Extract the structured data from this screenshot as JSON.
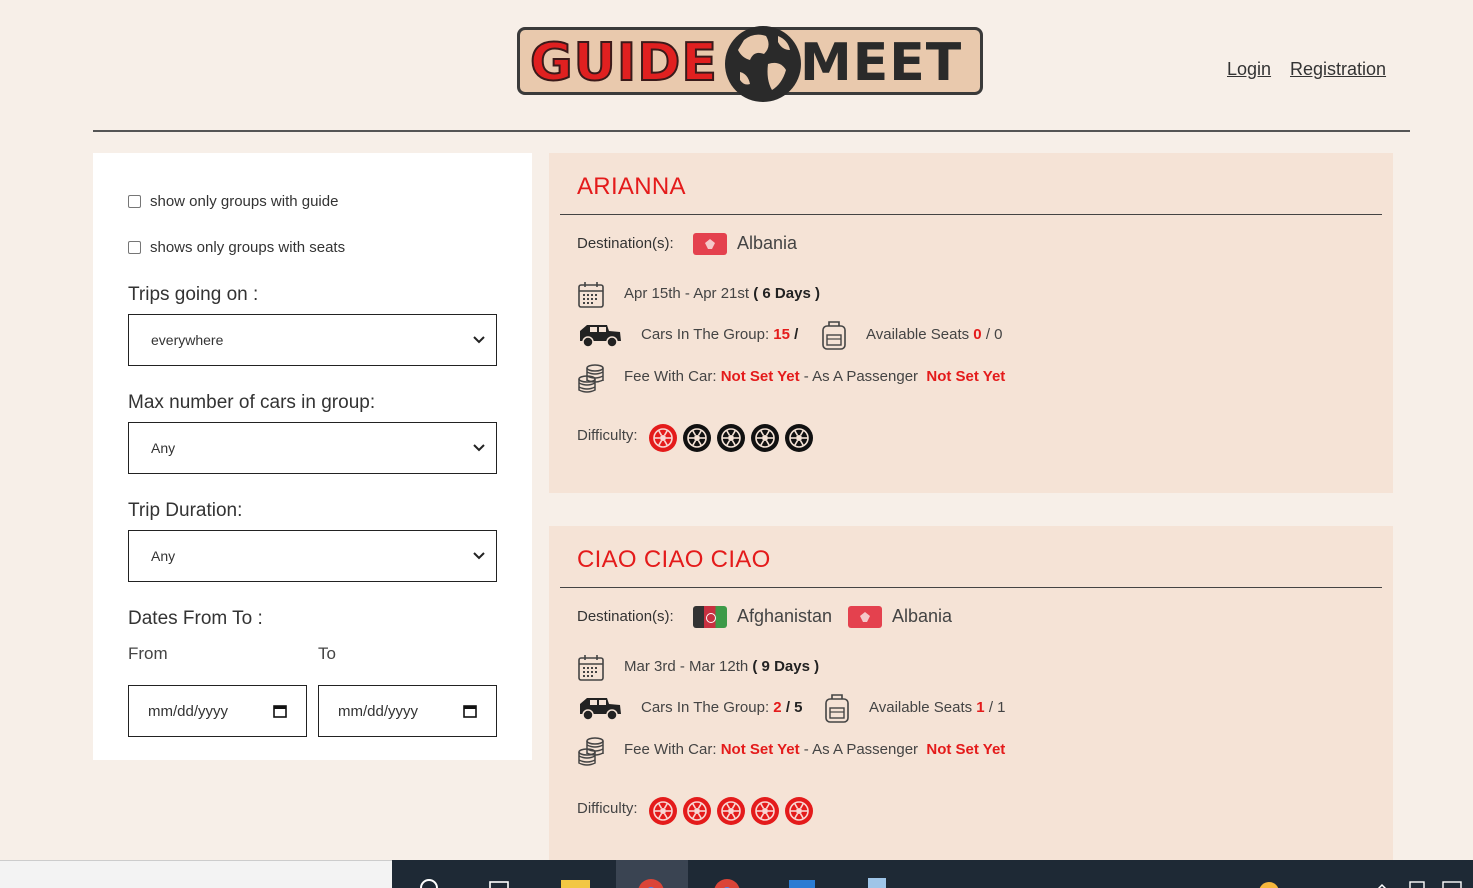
{
  "header": {
    "logo_text_left": "GUIDE",
    "logo_text_right": "MEET",
    "login": "Login",
    "registration": "Registration"
  },
  "filters": {
    "guide_checkbox_label": "show only groups with guide",
    "seats_checkbox_label": "shows only groups with seats",
    "trips_label": "Trips going on :",
    "trips_value": "everywhere",
    "cars_label": "Max number of cars in group:",
    "cars_value": "Any",
    "duration_label": "Trip Duration:",
    "duration_value": "Any",
    "dates_label": "Dates From To :",
    "from_label": "From",
    "to_label": "To",
    "from_placeholder": "mm/dd/yyyy",
    "to_placeholder": "mm/dd/yyyy"
  },
  "trips": [
    {
      "name": "ARIANNA",
      "dest_label": "Destination(s):",
      "destinations": [
        "Albania"
      ],
      "date_range": "Apr 15th - Apr 21st",
      "duration": "( 6 Days )",
      "cars_label": "Cars In The Group:",
      "cars_current": "15",
      "cars_sep": "/",
      "cars_max": "",
      "seats_label": "Available Seats",
      "seats_current": "0",
      "seats_sep": "/ 0",
      "fee_label": "Fee With Car:",
      "fee_car": "Not Set Yet",
      "fee_passenger_label": "- As A Passenger",
      "fee_passenger": "Not Set Yet",
      "difficulty_label": "Difficulty:",
      "difficulty": 1,
      "difficulty_max": 5
    },
    {
      "name": "CIAO CIAO CIAO",
      "dest_label": "Destination(s):",
      "destinations": [
        "Afghanistan",
        "Albania"
      ],
      "date_range": "Mar 3rd - Mar 12th",
      "duration": "( 9 Days )",
      "cars_label": "Cars In The Group:",
      "cars_current": "2",
      "cars_sep": "/ 5",
      "cars_max": "",
      "seats_label": "Available Seats",
      "seats_current": "1",
      "seats_sep": "/ 1",
      "fee_label": "Fee With Car:",
      "fee_car": "Not Set Yet",
      "fee_passenger_label": "- As A Passenger",
      "fee_passenger": "Not Set Yet",
      "difficulty_label": "Difficulty:",
      "difficulty": 5,
      "difficulty_max": 5
    }
  ],
  "colors": {
    "accent_red": "#e41b1b",
    "card_bg": "#f5e3d6",
    "page_bg": "#f7efe8"
  }
}
